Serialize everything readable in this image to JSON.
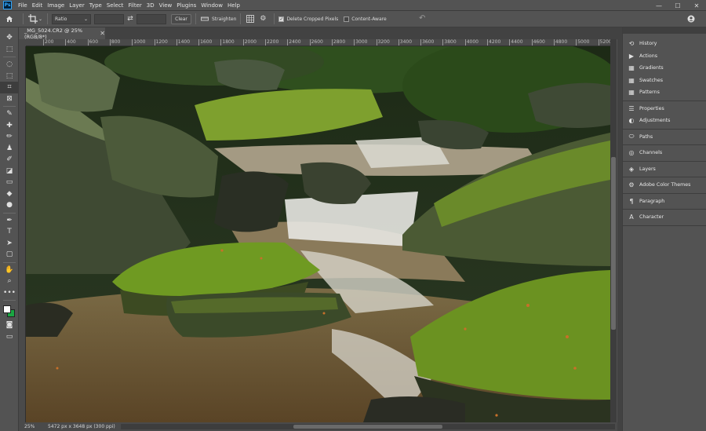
{
  "menu": {
    "logo": "Ps",
    "items": [
      "File",
      "Edit",
      "Image",
      "Layer",
      "Type",
      "Select",
      "Filter",
      "3D",
      "View",
      "Plugins",
      "Window",
      "Help"
    ],
    "minimize": "—",
    "maximize": "☐",
    "close": "✕"
  },
  "options": {
    "ratio_select": "Ratio",
    "swap": "⇄",
    "clear_label": "Clear",
    "straighten_label": "Straighten",
    "delete_cropped_label": "Delete Cropped Pixels",
    "delete_cropped_checked": true,
    "content_aware_label": "Content-Aware",
    "content_aware_checked": false,
    "reset": "↶"
  },
  "tools": [
    {
      "name": "move-tool",
      "glyph": "✥"
    },
    {
      "name": "marquee-tool",
      "glyph": "⬚"
    },
    {
      "name": "lasso-tool",
      "glyph": "◌"
    },
    {
      "name": "object-select-tool",
      "glyph": "⬚"
    },
    {
      "name": "crop-tool",
      "glyph": "⌗",
      "active": true
    },
    {
      "name": "frame-tool",
      "glyph": "⊠"
    },
    {
      "name": "eyedropper-tool",
      "glyph": "✎"
    },
    {
      "name": "healing-tool",
      "glyph": "✚"
    },
    {
      "name": "brush-tool",
      "glyph": "✏"
    },
    {
      "name": "stamp-tool",
      "glyph": "♟"
    },
    {
      "name": "history-brush-tool",
      "glyph": "✐"
    },
    {
      "name": "eraser-tool",
      "glyph": "◪"
    },
    {
      "name": "gradient-tool",
      "glyph": "▭"
    },
    {
      "name": "blur-tool",
      "glyph": "◆"
    },
    {
      "name": "dodge-tool",
      "glyph": "●"
    },
    {
      "name": "pen-tool",
      "glyph": "✒"
    },
    {
      "name": "type-tool",
      "glyph": "T"
    },
    {
      "name": "path-select-tool",
      "glyph": "➤"
    },
    {
      "name": "rectangle-tool",
      "glyph": "▢"
    },
    {
      "name": "hand-tool",
      "glyph": "✋"
    },
    {
      "name": "zoom-tool",
      "glyph": "⌕"
    },
    {
      "name": "more-tools",
      "glyph": "•••"
    }
  ],
  "colors": {
    "foreground": "#ffffff",
    "background": "#1aa542",
    "accent": "#31a8ff"
  },
  "document": {
    "tab_title": "_MG_5024.CR2 @ 25% (RGB/8*)",
    "close": "✕"
  },
  "ruler": {
    "ticks": [
      "200",
      "400",
      "600",
      "800",
      "1000",
      "1200",
      "1400",
      "1600",
      "1800",
      "2000",
      "2200",
      "2400",
      "2600",
      "2800",
      "3000",
      "3200",
      "3400",
      "3600",
      "3800",
      "4000",
      "4200",
      "4400",
      "4600",
      "4800",
      "5000",
      "5200"
    ]
  },
  "status": {
    "zoom": "25%",
    "dimensions": "5472 px x 3648 px (300 ppi)",
    "arrow": "›"
  },
  "panels": [
    {
      "group": 1,
      "items": [
        {
          "label": "History",
          "icon": "history-icon",
          "glyph": "⟲"
        },
        {
          "label": "Actions",
          "icon": "actions-icon",
          "glyph": "▶"
        },
        {
          "label": "Gradients",
          "icon": "gradients-icon",
          "glyph": "▦"
        },
        {
          "label": "Swatches",
          "icon": "swatches-icon",
          "glyph": "▦"
        },
        {
          "label": "Patterns",
          "icon": "patterns-icon",
          "glyph": "▦"
        }
      ]
    },
    {
      "group": 2,
      "items": [
        {
          "label": "Properties",
          "icon": "properties-icon",
          "glyph": "☰"
        },
        {
          "label": "Adjustments",
          "icon": "adjustments-icon",
          "glyph": "◐"
        }
      ]
    },
    {
      "group": 3,
      "items": [
        {
          "label": "Paths",
          "icon": "paths-icon",
          "glyph": "⬭"
        }
      ]
    },
    {
      "group": 4,
      "items": [
        {
          "label": "Channels",
          "icon": "channels-icon",
          "glyph": "◎"
        }
      ]
    },
    {
      "group": 5,
      "items": [
        {
          "label": "Layers",
          "icon": "layers-icon",
          "glyph": "◈"
        }
      ]
    },
    {
      "group": 6,
      "items": [
        {
          "label": "Adobe Color Themes",
          "icon": "color-themes-icon",
          "glyph": "⚙"
        }
      ]
    },
    {
      "group": 7,
      "items": [
        {
          "label": "Paragraph",
          "icon": "paragraph-icon",
          "glyph": "¶"
        }
      ]
    },
    {
      "group": 8,
      "items": [
        {
          "label": "Character",
          "icon": "character-icon",
          "glyph": "A"
        }
      ]
    }
  ]
}
